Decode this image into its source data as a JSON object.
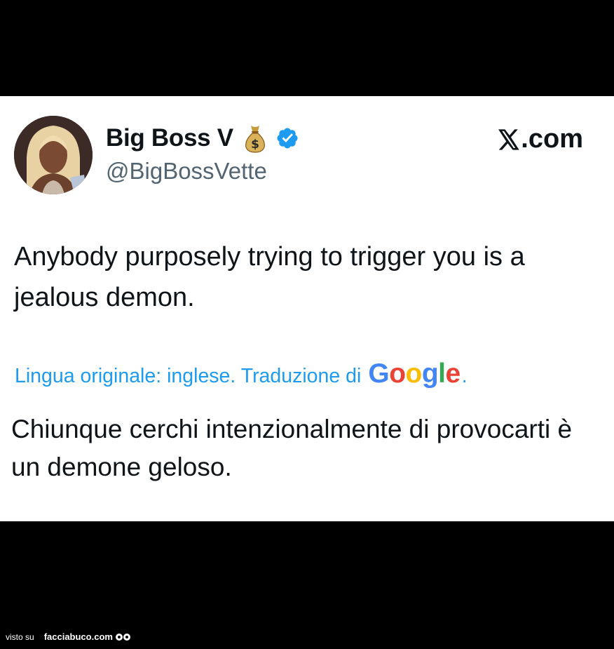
{
  "post": {
    "author": {
      "display_name": "Big Boss V",
      "handle": "@BigBossVette",
      "name_emoji": "money-bag-icon",
      "verified": true
    },
    "source_logo": ".com",
    "text": "Anybody purposely trying to trigger you is a jealous demon.",
    "translation_note": {
      "prefix": "Lingua originale: inglese. Traduzione di",
      "google_letters": [
        "G",
        "o",
        "o",
        "g",
        "l",
        "e"
      ],
      "suffix": "."
    },
    "translated_text": "Chiunque cerchi intenzionalmente di provocarti è un demone geloso."
  },
  "footer": {
    "visto_label": "visto su",
    "site": "facciabuco.com"
  },
  "colors": {
    "link_blue": "#1d9bf0",
    "text": "#0f1419",
    "handle_gray": "#536471",
    "verified_blue": "#1d9bf0"
  }
}
